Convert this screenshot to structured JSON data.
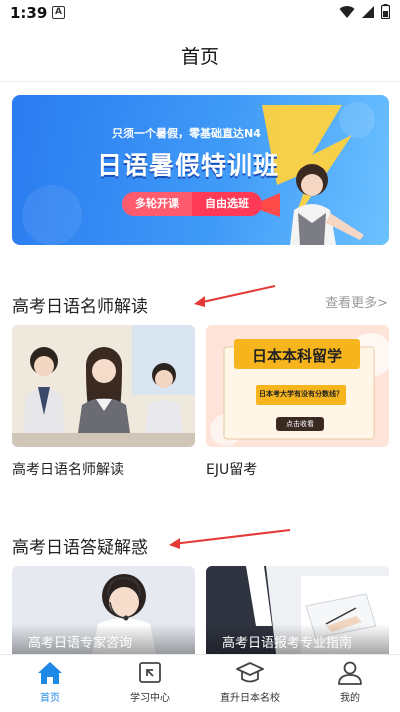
{
  "status_bar": {
    "time": "1:39",
    "notification_letter": "A"
  },
  "header": {
    "title": "首页"
  },
  "banner": {
    "subtitle": "只须一个暑假，零基础直达N4",
    "title": "日语暑假特训班",
    "tag_left": "多轮开课",
    "tag_right": "自由选班",
    "colors": {
      "background": "#2a7bf0",
      "pill": "#ff5b6e"
    }
  },
  "section_teachers": {
    "title": "高考日语名师解读",
    "more": "查看更多>",
    "cards": [
      {
        "label": "高考日语名师解读"
      },
      {
        "label": "EJU留考",
        "image_title": "日本本科留学",
        "image_subtitle": "日本考大学有没有分数线？",
        "image_button": "点击收看"
      }
    ]
  },
  "section_qa": {
    "title": "高考日语答疑解惑",
    "cards": [
      {
        "caption": "高考日语专家咨询"
      },
      {
        "caption": "高考日语报考专业指南"
      }
    ]
  },
  "bottom_nav": {
    "items": [
      {
        "label": "首页",
        "icon": "home-icon",
        "active": true
      },
      {
        "label": "学习中心",
        "icon": "study-center-icon",
        "active": false
      },
      {
        "label": "直升日本名校",
        "icon": "graduation-cap-icon",
        "active": false
      },
      {
        "label": "我的",
        "icon": "person-icon",
        "active": false
      }
    ],
    "active_color": "#1e88e5"
  }
}
